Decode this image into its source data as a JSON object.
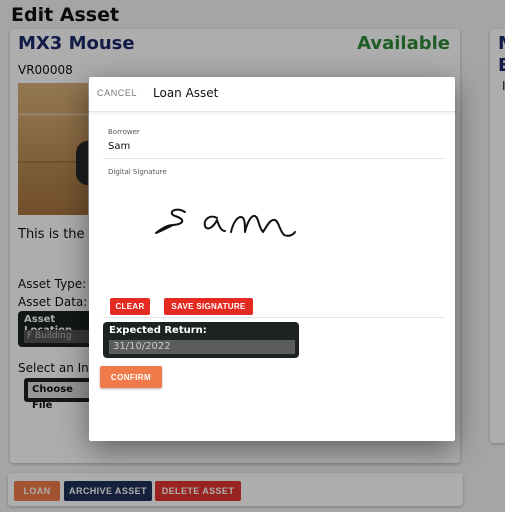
{
  "page": {
    "title": "Edit Asset"
  },
  "asset": {
    "name": "MX3 Mouse",
    "status": "Available",
    "id": "VR00008",
    "description": "This is the n",
    "asset_type_label": "Asset Type:",
    "asset_data_label": "Asset Data:",
    "location_label": "Asset Location",
    "location_value": "F Building",
    "image_label": "Select an In",
    "choose_file": "Choose File"
  },
  "right_card": {
    "title_line1": "M",
    "title_line2": "E",
    "line": "I"
  },
  "actions": {
    "loan": "LOAN",
    "archive": "ARCHIVE ASSET",
    "delete": "DELETE ASSET"
  },
  "colors": {
    "navy": "#1d2a6b",
    "green": "#2e8b3a",
    "orange": "#f07a4a",
    "red": "#e2342e",
    "dark": "#1c2322"
  },
  "modal": {
    "cancel": "CANCEL",
    "title": "Loan Asset",
    "borrower_label": "Borrower",
    "borrower_value": "Sam",
    "signature_label": "Digital Signature",
    "clear": "CLEAR",
    "save_signature": "SAVE SIGNATURE",
    "expected_return_label": "Expected Return:",
    "expected_return_value": "31/10/2022",
    "confirm": "CONFIRM"
  }
}
